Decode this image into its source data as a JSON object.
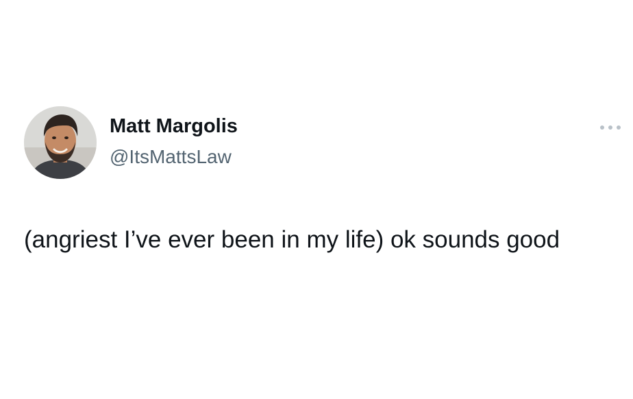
{
  "tweet": {
    "author": {
      "display_name": "Matt Margolis",
      "handle": "@ItsMattsLaw",
      "avatar": "profile-photo"
    },
    "more_icon": "more-horizontal-icon",
    "text": "(angriest I’ve ever been in my life) ok sounds good"
  },
  "colors": {
    "background": "#ffffff",
    "primary_text": "#0f1419",
    "secondary_text": "#536471",
    "icon": "#b9c1c8"
  }
}
